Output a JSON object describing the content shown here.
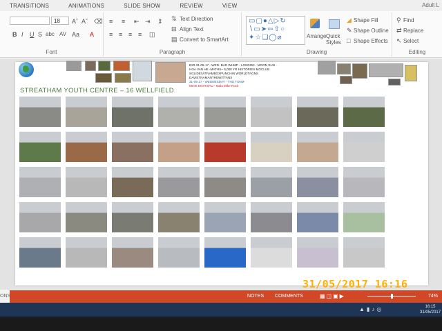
{
  "ribbon": {
    "tabs": [
      "TRANSITIONS",
      "ANIMATIONS",
      "SLIDE SHOW",
      "REVIEW",
      "VIEW"
    ],
    "user": "Adult L",
    "font_size": "18",
    "groups": {
      "font": "Font",
      "paragraph": "Paragraph",
      "drawing": "Drawing",
      "editing": "Editing"
    },
    "paragraph": {
      "text_direction": "Text Direction",
      "align_text": "Align Text",
      "convert_smartart": "Convert to SmartArt"
    },
    "drawing": {
      "arrange": "Arrange",
      "quick_styles": "Quick Styles",
      "shape_fill": "Shape Fill",
      "shape_outline": "Shape Outline",
      "shape_effects": "Shape Effects"
    },
    "editing": {
      "find": "Find",
      "replace": "Replace",
      "select": "Select"
    }
  },
  "slide": {
    "title": "STREATHAM YOUTH CENTRE – 16 WELLFIELD",
    "info_lines": [
      "B20-31-05-17 - WED- BAD WHMP - LONDON - MOON SUN -",
      "HOA VAN HE  -MATHS~ 5,000 YR HISTORIES MOCLUB",
      "SGLIDE/VITNAMBOXPUNCHIN WORLDTAGNS",
      "DAVIETNAMANTHEWITTANS",
      "31-05-17 - WEDNESDAY - THU TUNM",
      "08:05   DINH BAU - Mala Mike Rock"
    ]
  },
  "photo_colors": [
    [
      "#8a8a86",
      "#a8a49a",
      "#6f7268",
      "#b0b0ac",
      "#9a9a96",
      "#c2c2c2",
      "#6b6a5a",
      "#5d6a48"
    ],
    [
      "#5e7a4a",
      "#9a6a48",
      "#8a7060",
      "#c4a088",
      "#b83a2a",
      "#d8d0c0",
      "#c4a890",
      "#cfcfcf"
    ],
    [
      "#aeb0b4",
      "#b8b8b8",
      "#7a6a58",
      "#9a9a9c",
      "#8e8a86",
      "#9aa0a6",
      "#8a90a0",
      "#b8b8bc"
    ],
    [
      "#a8a8aa",
      "#8a8a80",
      "#7a7c74",
      "#8a8270",
      "#9aa4b4",
      "#8c8c90",
      "#7a8aa8",
      "#a8c0a0"
    ],
    [
      "#6a7a8a",
      "#b8b8b8",
      "#9a8a80",
      "#b8bcc0",
      "#2a68c8",
      "#dcdcdc",
      "#c8c0d0",
      "#c8c8c8"
    ]
  ],
  "statusbar": {
    "left": "ONS",
    "notes": "NOTES",
    "comments": "COMMENTS",
    "zoom": "74%"
  },
  "taskbar": {
    "time": "16:15",
    "date": "31/05/2017"
  },
  "camera_date": "31/05/2017  16:16"
}
